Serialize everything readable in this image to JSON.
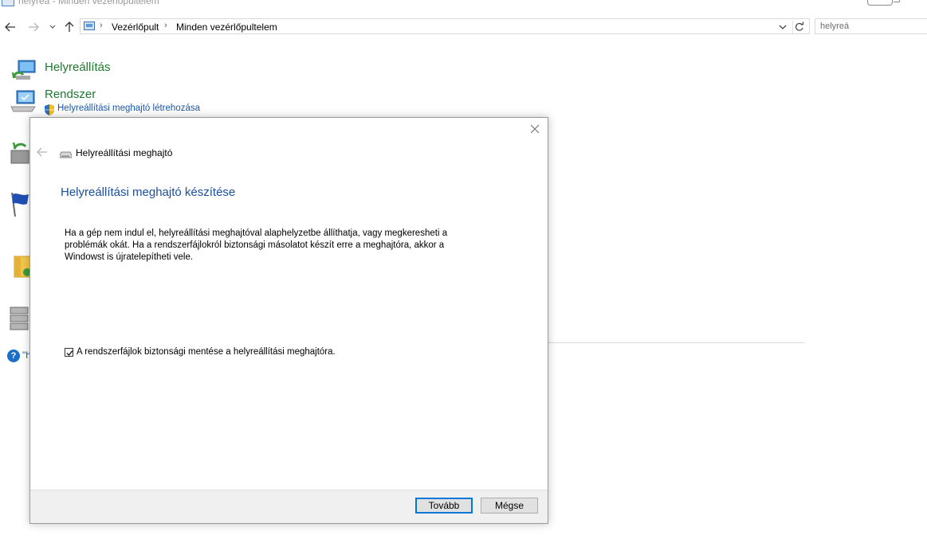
{
  "window": {
    "title": "helyreá - Minden vezérlőpultelem"
  },
  "nav": {
    "back_icon": "arrow-left-icon",
    "forward_icon": "arrow-right-icon",
    "recent_icon": "chevron-down-icon",
    "up_icon": "arrow-up-icon"
  },
  "address": {
    "breadcrumbs": [
      "Vezérlőpult",
      "Minden vezérlőpultelem"
    ]
  },
  "search": {
    "value": "helyreá"
  },
  "results": {
    "group1_title": "Helyreállítás",
    "group2_title": "Rendszer",
    "group2_link": "Helyreállítási meghajtó létrehozása",
    "help_fragment": "\"h"
  },
  "dialog": {
    "title": "Helyreállítási meghajtó",
    "heading": "Helyreállítási meghajtó készítése",
    "description_lines": [
      "Ha a gép nem indul el, helyreállítási meghajtóval alaphelyzetbe állíthatja, vagy megkeresheti a",
      "problémák okát. Ha a rendszerfájlokról biztonsági másolatot készít erre a meghajtóra, akkor a",
      "Windowst is újratelepítheti vele."
    ],
    "checkbox_label": "A rendszerfájlok biztonsági mentése a helyreállítási meghajtóra.",
    "checkbox_checked": true,
    "next_button": "Tovább",
    "cancel_button": "Mégse"
  },
  "colors": {
    "heading_green": "#1e7a2e",
    "link_blue": "#1a56a8",
    "dialog_heading_blue": "#1a4f9c",
    "primary_button_border": "#0078d7"
  }
}
